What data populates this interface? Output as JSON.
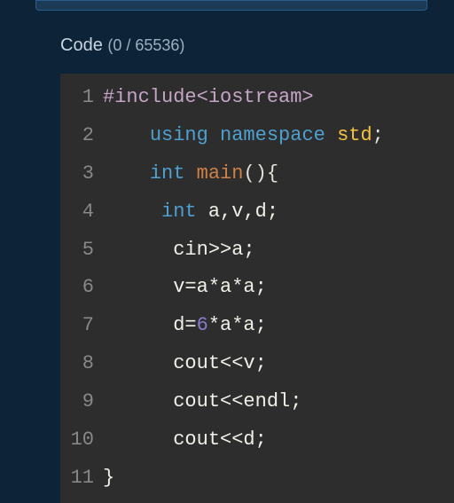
{
  "label": {
    "text": "Code",
    "counter": "(0 / 65536)"
  },
  "lines": [
    {
      "n": "1",
      "tokens": [
        [
          "preproc",
          "#include<iostream>"
        ]
      ]
    },
    {
      "n": "2",
      "tokens": [
        [
          "",
          "    "
        ],
        [
          "keyword",
          "using"
        ],
        [
          "",
          " "
        ],
        [
          "keyword",
          "namespace"
        ],
        [
          "",
          " "
        ],
        [
          "type",
          "std"
        ],
        [
          "punct",
          ";"
        ]
      ]
    },
    {
      "n": "3",
      "tokens": [
        [
          "",
          "    "
        ],
        [
          "keyword",
          "int"
        ],
        [
          "",
          " "
        ],
        [
          "func",
          "main"
        ],
        [
          "punct",
          "(){"
        ]
      ]
    },
    {
      "n": "4",
      "tokens": [
        [
          "",
          "     "
        ],
        [
          "keyword",
          "int"
        ],
        [
          "",
          " a,v,d;"
        ]
      ]
    },
    {
      "n": "5",
      "tokens": [
        [
          "",
          "      cin>>a;"
        ]
      ]
    },
    {
      "n": "6",
      "tokens": [
        [
          "",
          "      v=a*a*a;"
        ]
      ]
    },
    {
      "n": "7",
      "tokens": [
        [
          "",
          "      d="
        ],
        [
          "number",
          "6"
        ],
        [
          "",
          "*a*a;"
        ]
      ]
    },
    {
      "n": "8",
      "tokens": [
        [
          "",
          "      cout<<v;"
        ]
      ]
    },
    {
      "n": "9",
      "tokens": [
        [
          "",
          "      cout<<endl;"
        ]
      ]
    },
    {
      "n": "10",
      "tokens": [
        [
          "",
          "      cout<<d;"
        ]
      ]
    },
    {
      "n": "11",
      "tokens": [
        [
          "",
          "}"
        ]
      ]
    }
  ]
}
